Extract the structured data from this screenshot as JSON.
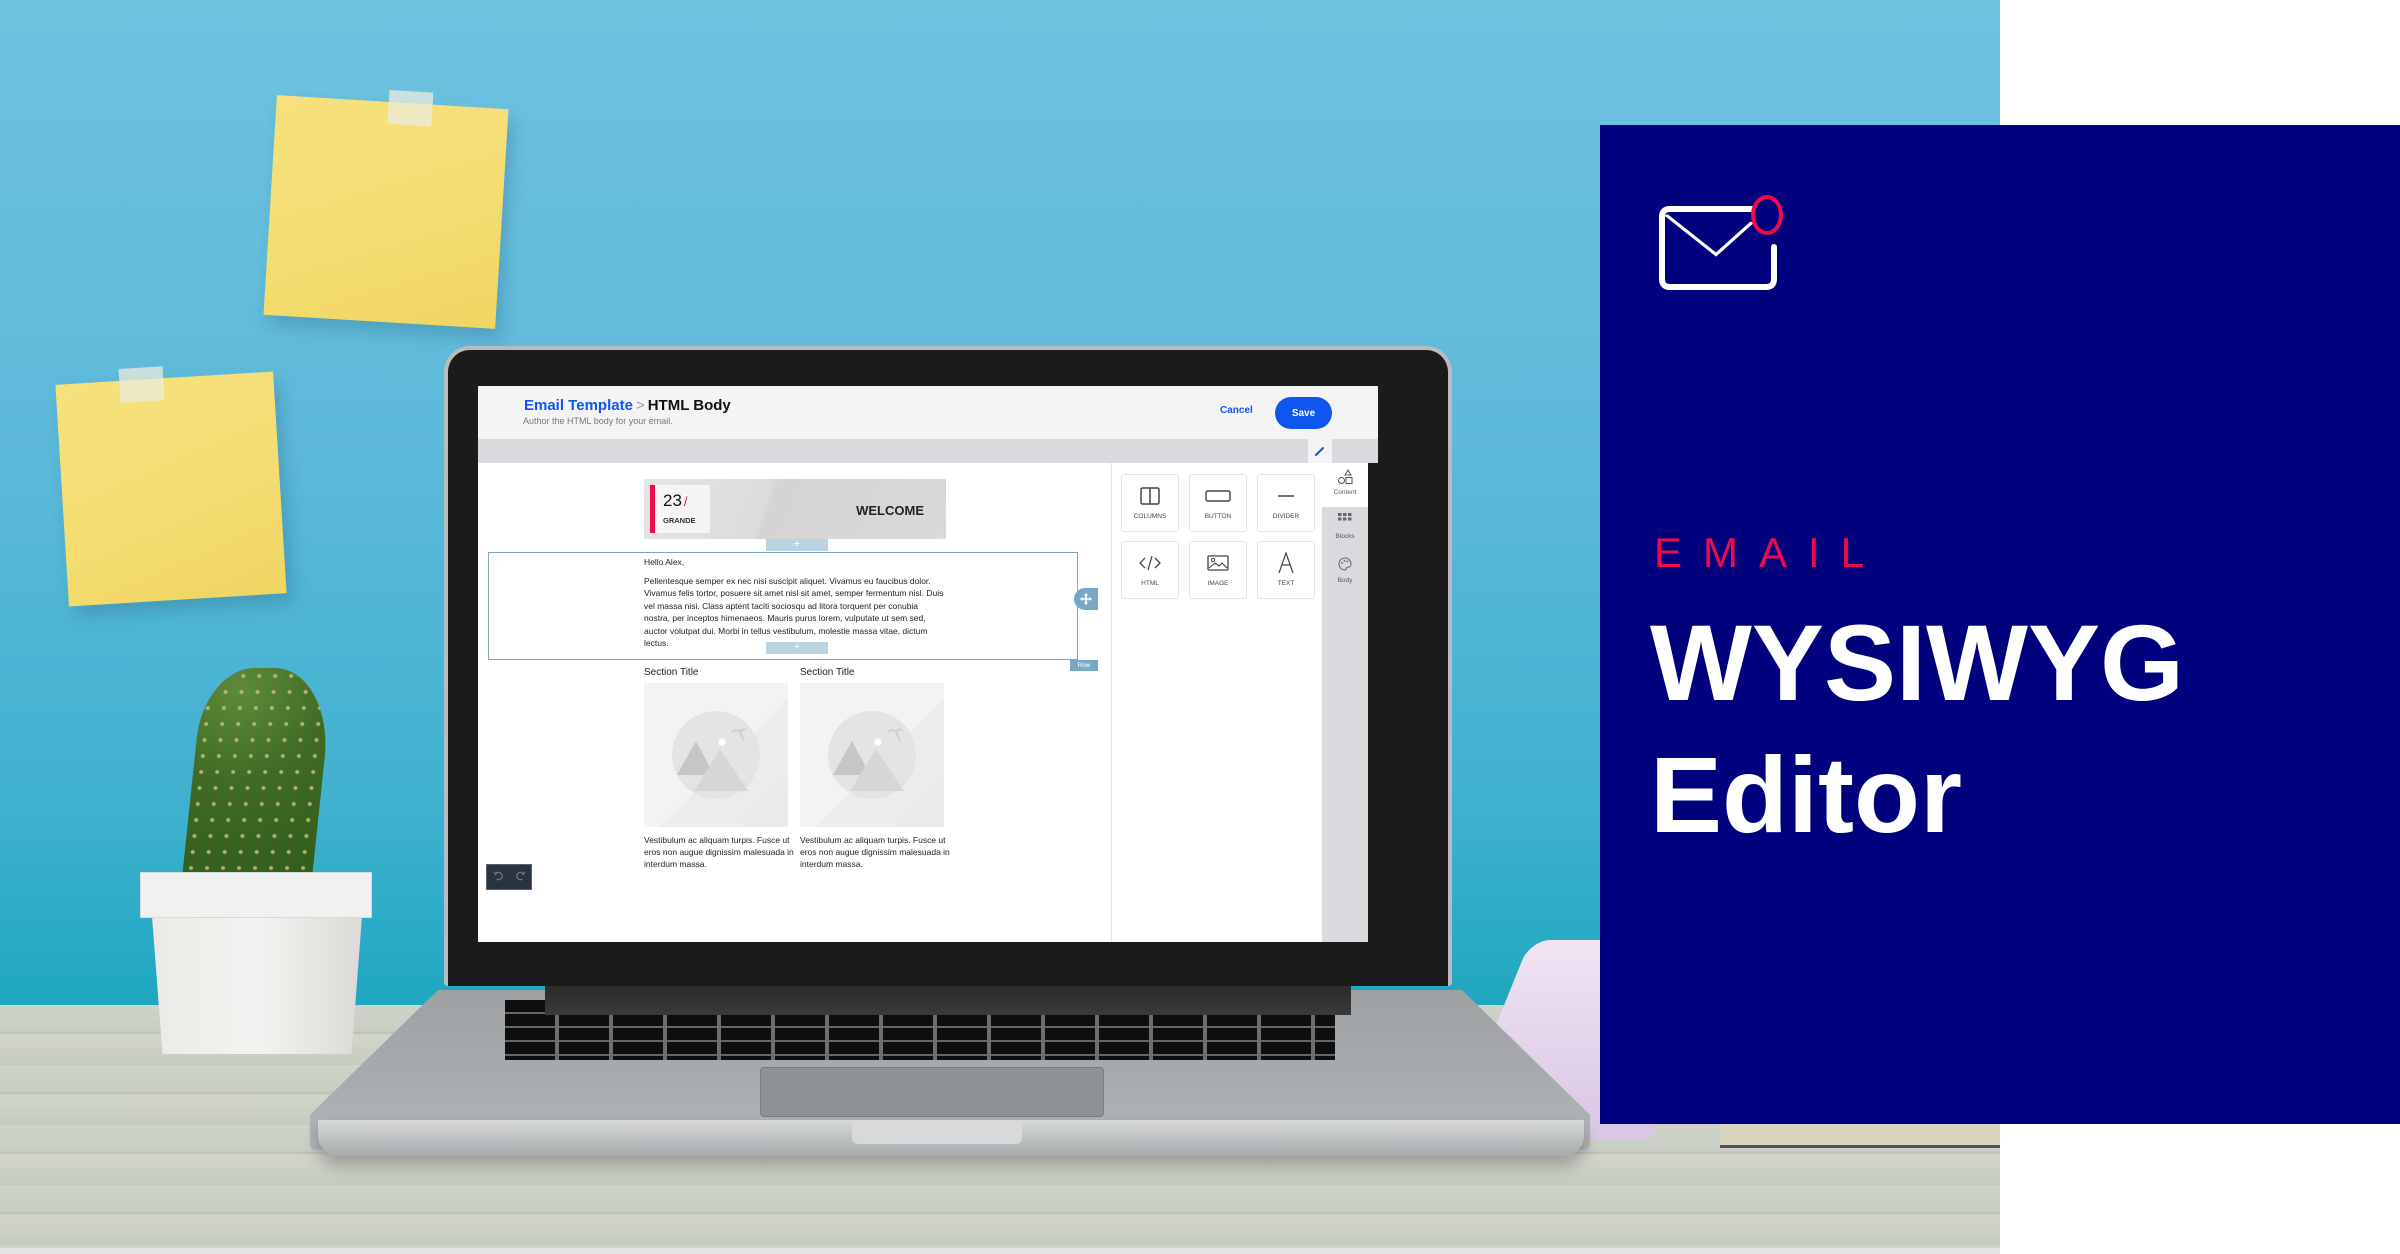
{
  "app": {
    "breadcrumb": {
      "parent": "Email Template",
      "separator": ">",
      "current": "HTML Body"
    },
    "subtitle": "Author the HTML body for your email.",
    "cancel_label": "Cancel",
    "save_label": "Save",
    "accent_color": "#0f55f0"
  },
  "canvas": {
    "banner": {
      "logo_number": "23",
      "logo_slash": "/",
      "logo_word": "GRANDE",
      "welcome": "WELCOME"
    },
    "add_symbol": "+",
    "greeting": "Hello Alex,",
    "body_text": "Pellentesque semper ex nec nisi suscipit aliquet. Vivamus eu faucibus dolor. Vivamus felis tortor, posuere sit amet nisl sit amet, semper fermentum nisl. Duis vel massa nisi. Class aptent taciti sociosqu ad litora torquent per conubia nostra, per inceptos himenaeos. Mauris purus lorem, vulputate ut sem sed, auctor volutpat dui. Morbi in tellus vestibulum, molestie massa vitae, dictum lectus.",
    "row_label": "Row",
    "columns": [
      {
        "title": "Section Title",
        "caption": "Vestibulum ac aliquam turpis. Fusce ut eros non augue dignissim malesuada in interdum massa."
      },
      {
        "title": "Section Title",
        "caption": "Vestibulum ac aliquam turpis. Fusce ut eros non augue dignissim malesuada in interdum massa."
      }
    ]
  },
  "panel": {
    "tiles": [
      {
        "label": "COLUMNS",
        "icon": "columns-icon"
      },
      {
        "label": "BUTTON",
        "icon": "button-icon"
      },
      {
        "label": "DIVIDER",
        "icon": "divider-icon"
      },
      {
        "label": "HTML",
        "icon": "code-icon"
      },
      {
        "label": "IMAGE",
        "icon": "image-icon"
      },
      {
        "label": "TEXT",
        "icon": "text-icon"
      }
    ],
    "tabs": [
      {
        "label": "Content",
        "icon": "shapes-icon",
        "active": true
      },
      {
        "label": "Blocks",
        "icon": "grid-icon",
        "active": false
      },
      {
        "label": "Body",
        "icon": "palette-icon",
        "active": false
      }
    ]
  },
  "promo": {
    "eyebrow": "EMAIL",
    "headline_line1": "WYSIWYG",
    "headline_line2": "Editor",
    "background_color": "#01017e",
    "eyebrow_color": "#ee0a4c"
  }
}
